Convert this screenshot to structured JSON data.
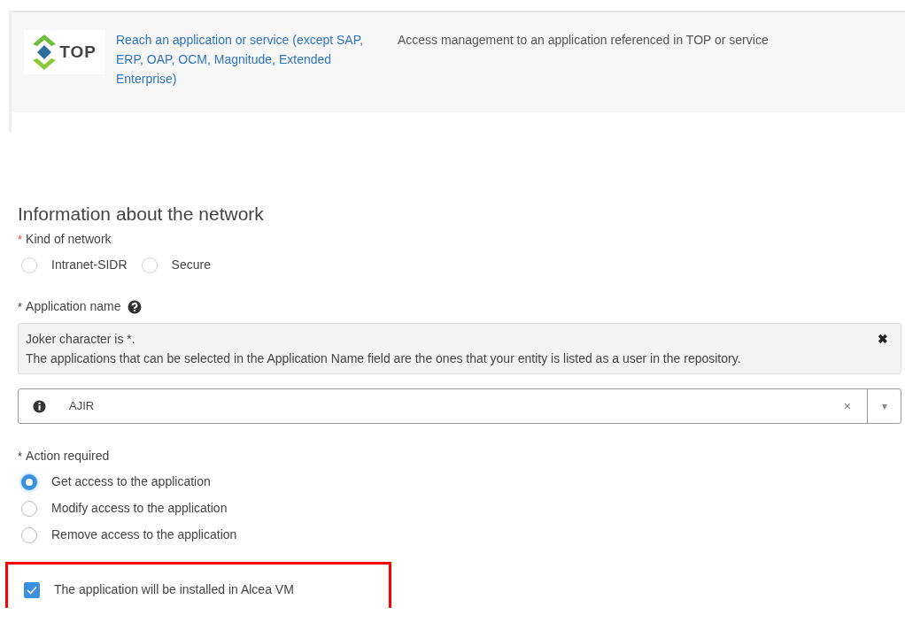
{
  "service": {
    "logo_text": "TOP",
    "link": "Reach an application or service (except SAP, ERP, OAP, OCM, Magnitude, Extended Enterprise)",
    "description": "Access management to an application referenced in TOP or service"
  },
  "section": {
    "title": "Information about the network"
  },
  "network": {
    "label": "Kind of network",
    "required_mark": "*",
    "options": [
      {
        "label": "Intranet-SIDR",
        "selected": false
      },
      {
        "label": "Secure",
        "selected": false
      }
    ]
  },
  "application": {
    "label": "Application name",
    "required_mark": "*",
    "help": {
      "lines": [
        "Joker character is *.",
        "The applications that can be selected in the Application Name field are the ones that your entity is listed as a user in the repository."
      ],
      "close": "✖"
    },
    "value": "AJIR",
    "clear": "×",
    "caret": "▾"
  },
  "action": {
    "label": "Action required",
    "required_mark": "*",
    "options": [
      {
        "label": "Get access to the application",
        "selected": true
      },
      {
        "label": "Modify access to the application",
        "selected": false
      },
      {
        "label": "Remove access to the application",
        "selected": false
      }
    ]
  },
  "alcea": {
    "label": "The application will be installed in Alcea VM",
    "checked": true,
    "highlighted": true
  }
}
